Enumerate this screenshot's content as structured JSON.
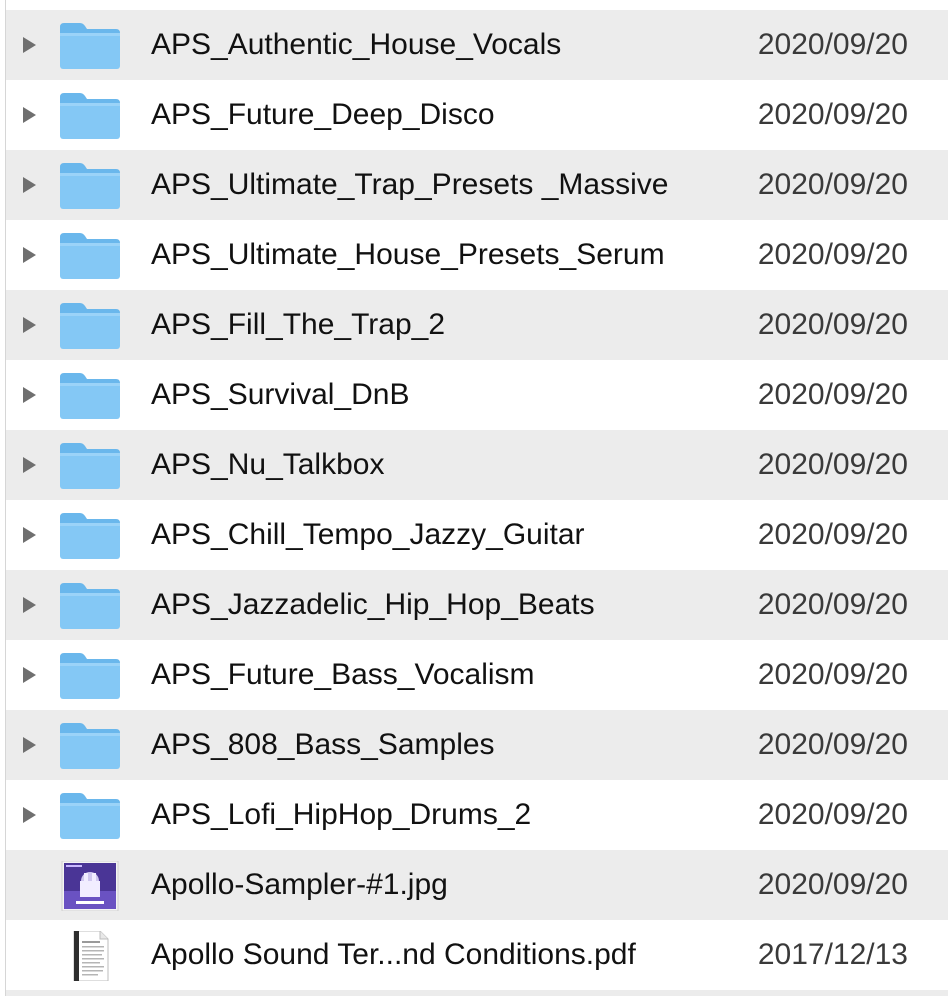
{
  "items": [
    {
      "name": "APS_Authentic_House_Vocals",
      "date": "2020/09/20",
      "kind": "folder",
      "icon": "folder-icon"
    },
    {
      "name": "APS_Future_Deep_Disco",
      "date": "2020/09/20",
      "kind": "folder",
      "icon": "folder-icon"
    },
    {
      "name": "APS_Ultimate_Trap_Presets _Massive",
      "date": "2020/09/20",
      "kind": "folder",
      "icon": "folder-icon"
    },
    {
      "name": "APS_Ultimate_House_Presets_Serum",
      "date": "2020/09/20",
      "kind": "folder",
      "icon": "folder-icon"
    },
    {
      "name": "APS_Fill_The_Trap_2",
      "date": "2020/09/20",
      "kind": "folder",
      "icon": "folder-icon"
    },
    {
      "name": "APS_Survival_DnB",
      "date": "2020/09/20",
      "kind": "folder",
      "icon": "folder-icon"
    },
    {
      "name": "APS_Nu_Talkbox",
      "date": "2020/09/20",
      "kind": "folder",
      "icon": "folder-icon"
    },
    {
      "name": "APS_Chill_Tempo_Jazzy_Guitar",
      "date": "2020/09/20",
      "kind": "folder",
      "icon": "folder-icon"
    },
    {
      "name": "APS_Jazzadelic_Hip_Hop_Beats",
      "date": "2020/09/20",
      "kind": "folder",
      "icon": "folder-icon"
    },
    {
      "name": "APS_Future_Bass_Vocalism",
      "date": "2020/09/20",
      "kind": "folder",
      "icon": "folder-icon"
    },
    {
      "name": "APS_808_Bass_Samples",
      "date": "2020/09/20",
      "kind": "folder",
      "icon": "folder-icon"
    },
    {
      "name": "APS_Lofi_HipHop_Drums_2",
      "date": "2020/09/20",
      "kind": "folder",
      "icon": "folder-icon"
    },
    {
      "name": "Apollo-Sampler-#1.jpg",
      "date": "2020/09/20",
      "kind": "image",
      "icon": "image-thumbnail-icon"
    },
    {
      "name": "Apollo Sound Ter...nd Conditions.pdf",
      "date": "2017/12/13",
      "kind": "pdf",
      "icon": "pdf-document-icon"
    }
  ],
  "colors": {
    "row_shaded": "#ececec",
    "row_plain": "#ffffff",
    "folder_blue": "#84c8f5",
    "folder_blue_dark": "#6ab7ec",
    "thumb_purple": "#5b3fa8"
  }
}
